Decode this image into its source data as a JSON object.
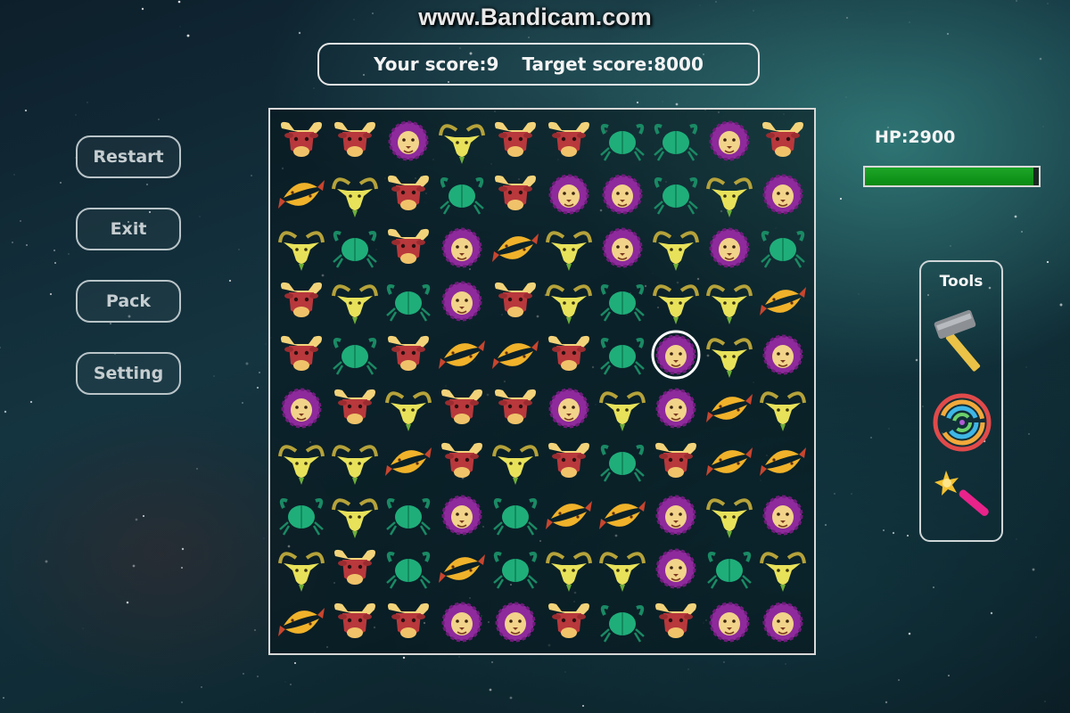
{
  "watermark": "www.Bandicam.com",
  "score": {
    "your_score": "Your score:9",
    "target_score": "Target score:8000"
  },
  "menu": {
    "restart": "Restart",
    "exit": "Exit",
    "pack": "Pack",
    "setting": "Setting"
  },
  "hp": {
    "label": "HP:2900",
    "fill_fraction": 0.97
  },
  "tools": {
    "title": "Tools",
    "items": [
      "hammer-icon",
      "swirl-icon",
      "magic-wand-icon"
    ]
  },
  "board": {
    "rows": 10,
    "cols": 10,
    "legend": {
      "T": "taurus-bull",
      "L": "leo-lion",
      "G": "capricorn-goat",
      "C": "cancer-crab",
      "P": "pisces-fish"
    },
    "grid": [
      "TTLGTTCCLT",
      "PGTCTLLCGL",
      "GCTLPGLGLC",
      "TGCLTGCGGP",
      "TCTPPTCLGL",
      "LTGTTLGLPG",
      "GGPTGTCTPP",
      "CGCLCPPLGL",
      "GTCPCGGLCG",
      "PTTLLTCTLL"
    ],
    "selected": {
      "row": 4,
      "col": 7
    }
  },
  "colors": {
    "bull": "#b8383c",
    "lion_mane": "#8e2a9c",
    "lion_face": "#f2d38a",
    "goat": "#e8e25a",
    "crab": "#1fae7a",
    "fish": "#f0b22a",
    "hp_green": "#10a21c"
  }
}
